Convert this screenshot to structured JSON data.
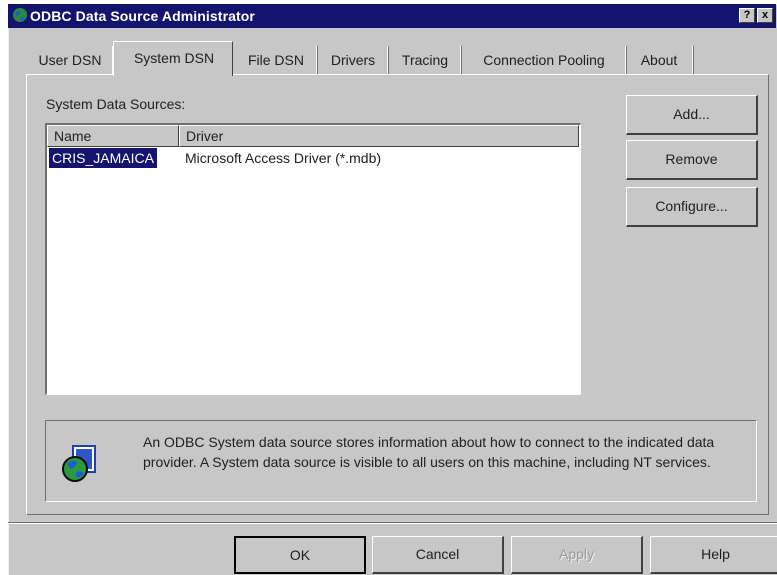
{
  "window": {
    "title": "ODBC Data Source Administrator",
    "help_glyph": "?",
    "close_glyph": "x"
  },
  "tabs": [
    {
      "label": "User DSN"
    },
    {
      "label": "System DSN"
    },
    {
      "label": "File DSN"
    },
    {
      "label": "Drivers"
    },
    {
      "label": "Tracing"
    },
    {
      "label": "Connection Pooling"
    },
    {
      "label": "About"
    }
  ],
  "system_dsn": {
    "list_label": "System Data Sources:",
    "columns": {
      "name": "Name",
      "driver": "Driver"
    },
    "rows": [
      {
        "name": "CRIS_JAMAICA",
        "driver": "Microsoft Access Driver (*.mdb)"
      }
    ],
    "buttons": {
      "add": "Add...",
      "remove": "Remove",
      "configure": "Configure..."
    },
    "info": "An ODBC System data source stores information about how to connect to the indicated data provider.  A System data source is visible to all users on this machine, including NT services."
  },
  "dialog_buttons": {
    "ok": "OK",
    "cancel": "Cancel",
    "apply": "Apply",
    "help": "Help"
  },
  "colors": {
    "title_bar": "#14146e",
    "face": "#c7c7c7",
    "selection": "#14146e"
  }
}
